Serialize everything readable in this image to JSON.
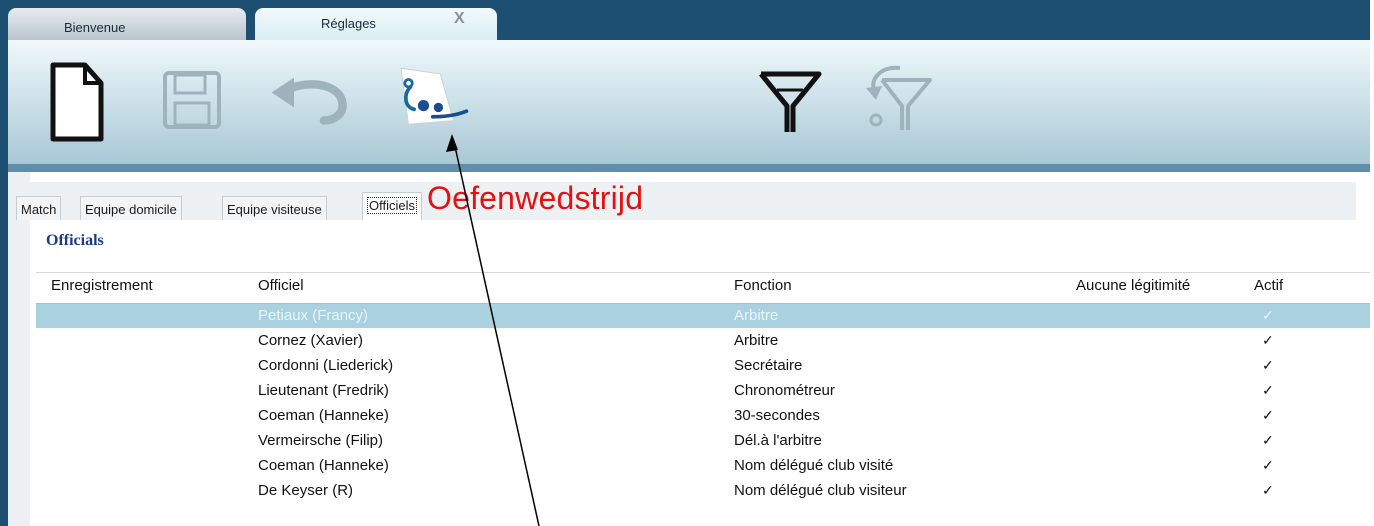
{
  "tabs": {
    "bienvenue": "Bienvenue",
    "reglages": "Réglages",
    "close": "X"
  },
  "toolbar": {
    "icons": [
      "new-document-icon",
      "save-icon",
      "undo-icon",
      "handball-referee-icon",
      "filter-icon",
      "clear-filter-icon"
    ]
  },
  "subtabs": [
    "Match",
    "Equipe domicile",
    "Equipe visiteuse",
    "Officiels"
  ],
  "overlay_text": "Oefenwedstrijd",
  "section_title": "Officials",
  "table": {
    "columns": [
      "Enregistrement",
      "Officiel",
      "Fonction",
      "Aucune légitimité",
      "Actif"
    ],
    "rows": [
      {
        "enregistrement": "",
        "officiel": "Petiaux (Francy)",
        "fonction": "Arbitre",
        "aucune": "",
        "actif": "✓",
        "selected": true
      },
      {
        "enregistrement": "",
        "officiel": "Cornez (Xavier)",
        "fonction": "Arbitre",
        "aucune": "",
        "actif": "✓",
        "selected": false
      },
      {
        "enregistrement": "",
        "officiel": "Cordonni (Liederick)",
        "fonction": "Secrétaire",
        "aucune": "",
        "actif": "✓",
        "selected": false
      },
      {
        "enregistrement": "",
        "officiel": "Lieutenant (Fredrik)",
        "fonction": "Chronométreur",
        "aucune": "",
        "actif": "✓",
        "selected": false
      },
      {
        "enregistrement": "",
        "officiel": "Coeman (Hanneke)",
        "fonction": "30-secondes",
        "aucune": "",
        "actif": "✓",
        "selected": false
      },
      {
        "enregistrement": "",
        "officiel": "Vermeirsche (Filip)",
        "fonction": "Dél.à l'arbitre",
        "aucune": "",
        "actif": "✓",
        "selected": false
      },
      {
        "enregistrement": "",
        "officiel": "Coeman (Hanneke)",
        "fonction": "Nom délégué club visité",
        "aucune": "",
        "actif": "✓",
        "selected": false
      },
      {
        "enregistrement": "",
        "officiel": "De Keyser (R)",
        "fonction": "Nom délégué club visiteur",
        "aucune": "",
        "actif": "✓",
        "selected": false
      }
    ]
  },
  "colors": {
    "frame": "#1d4f73",
    "selection": "#a9d1e0",
    "overlay": "#e21212",
    "section_title": "#1b3a86"
  }
}
